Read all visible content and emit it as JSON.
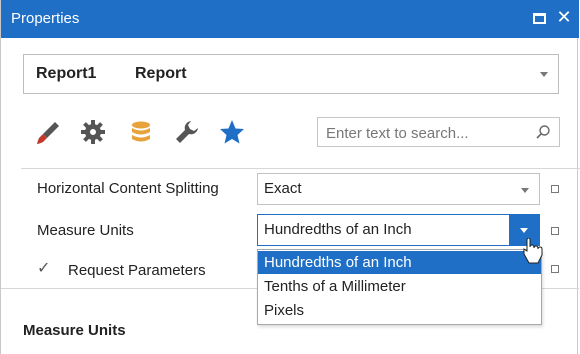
{
  "window": {
    "title": "Properties",
    "accent_color": "#1e6fc5"
  },
  "object_selector": {
    "name": "Report1",
    "type": "Report"
  },
  "tabs": [
    {
      "icon": "brush-icon",
      "color": "#c0392b"
    },
    {
      "icon": "gear-icon",
      "color": "#555555"
    },
    {
      "icon": "database-icon",
      "color": "#e8a23c"
    },
    {
      "icon": "wrench-icon",
      "color": "#555555"
    },
    {
      "icon": "star-icon",
      "color": "#1e6fc5"
    }
  ],
  "search": {
    "placeholder": "Enter text to search..."
  },
  "properties": {
    "horizontal_content_splitting": {
      "label": "Horizontal Content Splitting",
      "value": "Exact"
    },
    "measure_units": {
      "label": "Measure Units",
      "value": "Hundredths of an Inch"
    },
    "request_parameters": {
      "label": "Request Parameters",
      "checked": true,
      "check_glyph": "✓"
    }
  },
  "dropdown": {
    "options": [
      "Hundredths of an Inch",
      "Tenths of a Millimeter",
      "Pixels"
    ],
    "selected_index": 0
  },
  "description": {
    "title": "Measure Units"
  }
}
